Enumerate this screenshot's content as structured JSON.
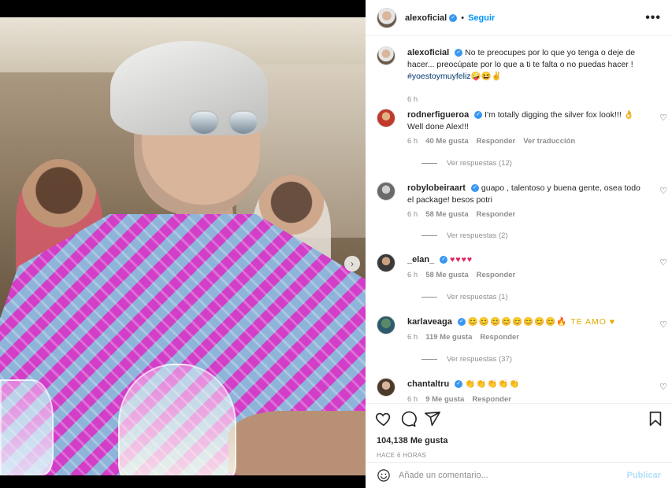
{
  "post": {
    "carousel_dots": 4,
    "active_dot": 0,
    "next_icon": "chevron-right-icon",
    "next_glyph": "›"
  },
  "header": {
    "username": "alexoficial",
    "separator": "•",
    "follow_label": "Seguir",
    "more_glyph": "•••"
  },
  "caption": {
    "username": "alexoficial",
    "text": "No te preocupes por lo que yo tenga o deje de hacer... preocúpate por lo que a ti te falta o no puedas hacer !",
    "hashtag": "#yoestoymuyfeliz",
    "emojis": "🤪😆✌",
    "time": "6 h"
  },
  "comments": [
    {
      "username": "rodnerfigueroa",
      "verified": true,
      "text": "I'm totally digging the silver fox look!!! 👌 Well done Alex!!!",
      "time": "6 h",
      "likes": "40 Me gusta",
      "reply": "Responder",
      "translate": "Ver traducción",
      "replies": "Ver respuestas (12)"
    },
    {
      "username": "robylobeiraart",
      "verified": true,
      "text": "guapo , talentoso y buena gente, osea todo el package! besos potri",
      "time": "6 h",
      "likes": "58 Me gusta",
      "reply": "Responder",
      "replies": "Ver respuestas (2)"
    },
    {
      "username": "_elan_",
      "verified": true,
      "text": "♥♥♥♥",
      "time": "6 h",
      "likes": "58 Me gusta",
      "reply": "Responder",
      "replies": "Ver respuestas (1)"
    },
    {
      "username": "karlaveaga",
      "verified": true,
      "text": "😊😊😊😊😊😊😊😊🔥 TE AMO ♥",
      "time": "6 h",
      "likes": "119 Me gusta",
      "reply": "Responder",
      "replies": "Ver respuestas (37)"
    },
    {
      "username": "chantaltru",
      "verified": true,
      "text": "👏👏👏👏👏",
      "time": "6 h",
      "likes": "9 Me gusta",
      "reply": "Responder"
    }
  ],
  "actions": {
    "like_icon": "heart-outline-icon",
    "comment_icon": "comment-icon",
    "share_icon": "paper-plane-icon",
    "save_icon": "bookmark-icon"
  },
  "likes_text": "104,138 Me gusta",
  "posted_ago": "HACE 6 HORAS",
  "composer": {
    "emoji_icon": "smiley-icon",
    "placeholder": "Añade un comentario...",
    "publish_label": "Publicar"
  },
  "colors": {
    "accent": "#0095f6",
    "verified": "#3897f0",
    "muted": "#8e8e8e",
    "heart_red": "#e0245e"
  }
}
